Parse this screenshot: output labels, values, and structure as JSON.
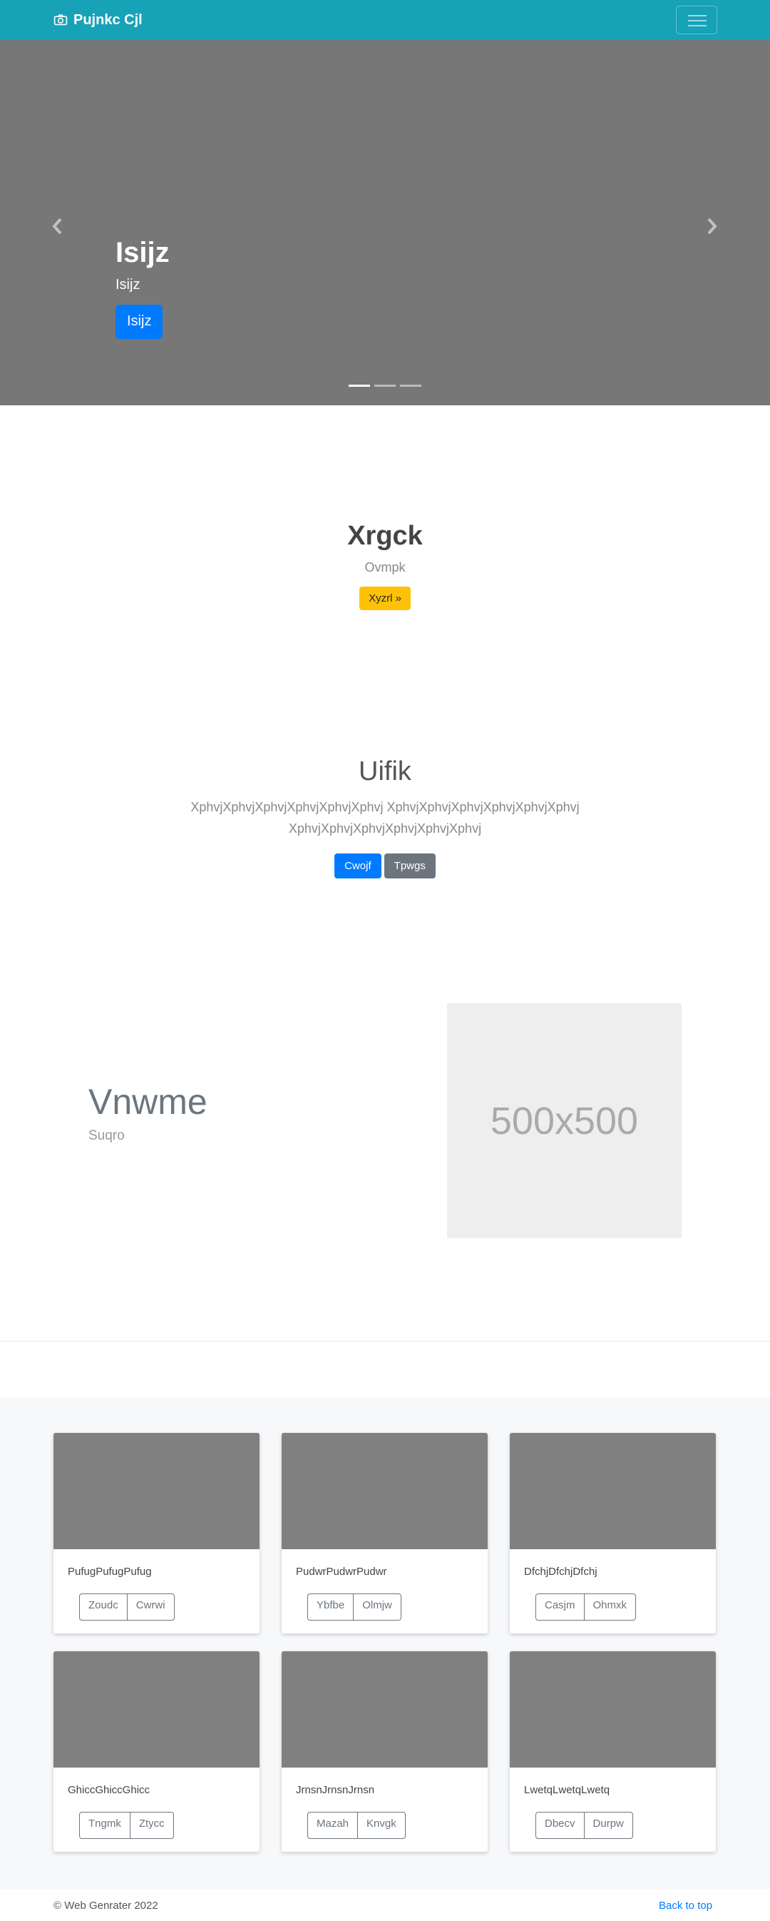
{
  "navbar": {
    "brand": "Pujnkc Cjl",
    "brand_icon": "camera-icon",
    "bg": "#17a2b8"
  },
  "carousel": {
    "slide_title": "Isijz",
    "slide_subtitle": "Isijz",
    "slide_button": "Isijz",
    "indicator_count": 3,
    "active_indicator": 1
  },
  "hero1": {
    "title": "Xrgck",
    "subtitle": "Ovmpk",
    "button": "Xyzrl »"
  },
  "hero2": {
    "title": "Uifik",
    "text": "XphvjXphvjXphvjXphvjXphvjXphvj XphvjXphvjXphvjXphvjXphvjXphvj XphvjXphvjXphvjXphvjXphvjXphvj",
    "primary_button": "Cwojf",
    "secondary_button": "Tpwgs"
  },
  "feature": {
    "title": "Vnwme",
    "subtitle": "Suqro",
    "image_label": "500x500"
  },
  "cards": [
    {
      "text": "PufugPufugPufug",
      "btn1": "Zoudc",
      "btn2": "Cwrwi"
    },
    {
      "text": "PudwrPudwrPudwr",
      "btn1": "Ybfbe",
      "btn2": "Olmjw"
    },
    {
      "text": "DfchjDfchjDfchj",
      "btn1": "Casjm",
      "btn2": "Ohmxk"
    },
    {
      "text": "GhiccGhiccGhicc",
      "btn1": "Tngmk",
      "btn2": "Ztycc"
    },
    {
      "text": "JrnsnJrnsnJrnsn",
      "btn1": "Mazah",
      "btn2": "Knvgk"
    },
    {
      "text": "LwetqLwetqLwetq",
      "btn1": "Dbecv",
      "btn2": "Durpw"
    }
  ],
  "footer": {
    "copyright": "© Web Genrater 2022",
    "back_to_top": "Back to top"
  }
}
